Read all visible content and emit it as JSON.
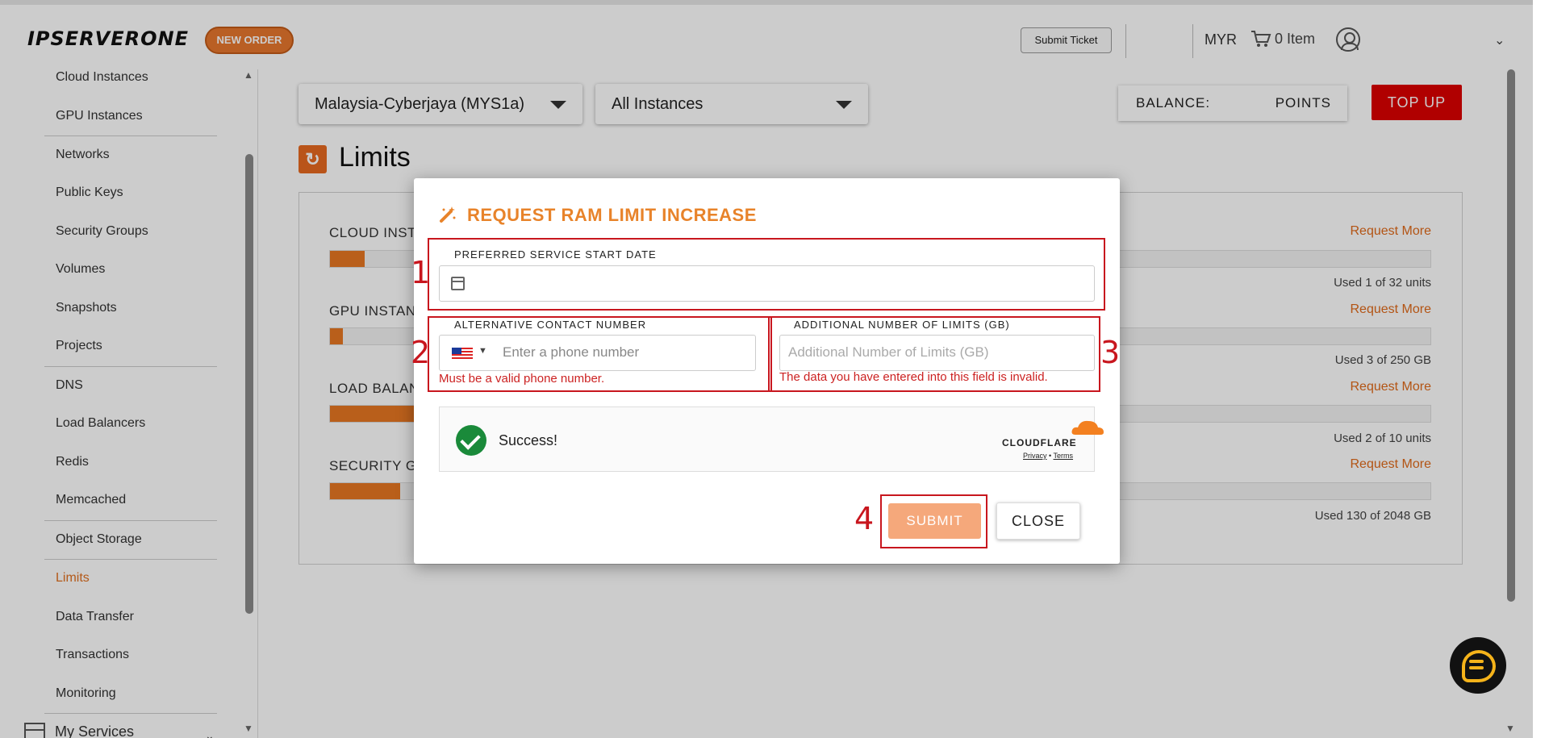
{
  "header": {
    "logo": "IPSERVERONE",
    "new_order": "NEW ORDER",
    "submit_ticket": "Submit Ticket",
    "currency": "MYR",
    "cart": "0 Item"
  },
  "sidebar": {
    "items": [
      {
        "label": "Cloud Instances"
      },
      {
        "label": "GPU Instances"
      },
      {
        "label": "Networks"
      },
      {
        "label": "Public Keys"
      },
      {
        "label": "Security Groups"
      },
      {
        "label": "Volumes"
      },
      {
        "label": "Snapshots"
      },
      {
        "label": "Projects"
      },
      {
        "label": "DNS"
      },
      {
        "label": "Load Balancers"
      },
      {
        "label": "Redis"
      },
      {
        "label": "Memcached"
      },
      {
        "label": "Object Storage"
      },
      {
        "label": "Limits"
      },
      {
        "label": "Data Transfer"
      },
      {
        "label": "Transactions"
      },
      {
        "label": "Monitoring"
      }
    ],
    "my_services": "My Services"
  },
  "main": {
    "region": "Malaysia-Cyberjaya (MYS1a)",
    "instances": "All Instances",
    "balance_label": "BALANCE:",
    "points_label": "POINTS",
    "top_up": "TOP UP",
    "title": "Limits",
    "limits": [
      {
        "label": "CLOUD INST",
        "request": "Request More",
        "used": "Used 1 of 32 units",
        "fraction": 0.03125
      },
      {
        "label": "GPU INSTAN",
        "request": "Request More",
        "used": "Used 3 of 250 GB",
        "fraction": 0.012
      },
      {
        "label": "LOAD BALAN",
        "request": "Request More",
        "used": "Used 2 of 10 units",
        "fraction": 0.2
      },
      {
        "label": "SECURITY GI",
        "request": "Request More",
        "used": "Used 130 of 2048 GB",
        "fraction": 0.0635
      }
    ]
  },
  "modal": {
    "title": "REQUEST RAM LIMIT INCREASE",
    "start_date_label": "PREFERRED SERVICE START DATE",
    "contact_label": "ALTERNATIVE CONTACT NUMBER",
    "contact_placeholder": "Enter a phone number",
    "contact_error": "Must be a valid phone number.",
    "limits_label": "ADDITIONAL NUMBER OF LIMITS (GB)",
    "limits_placeholder": "Additional Number of Limits (GB)",
    "limits_error": "The data you have entered into this field is invalid.",
    "captcha_status": "Success!",
    "captcha_brand": "CLOUDFLARE",
    "captcha_privacy": "Privacy",
    "captcha_terms": "Terms",
    "submit": "SUBMIT",
    "close": "CLOSE"
  },
  "annotations": [
    "1",
    "2",
    "3",
    "4"
  ],
  "colors": {
    "accent": "#e8772e",
    "danger": "#dd0000",
    "annotation": "#c8161e",
    "success": "#1a8a3a"
  }
}
